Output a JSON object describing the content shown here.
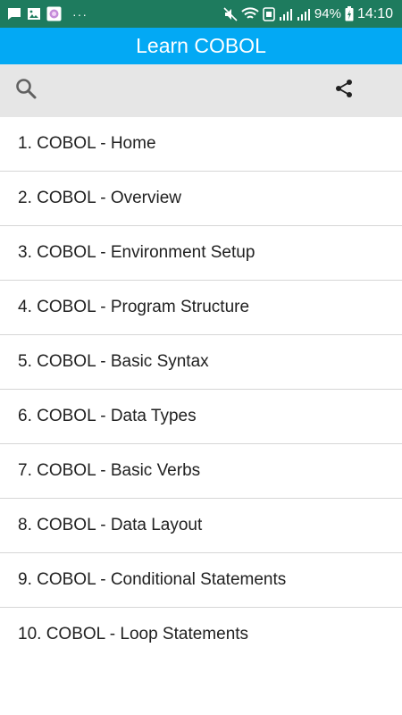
{
  "status_bar": {
    "battery": "94%",
    "time": "14:10",
    "overflow": "···",
    "icons": [
      "message-icon",
      "gallery-icon",
      "app-icon",
      "mute-icon",
      "wifi-icon",
      "nfc-icon",
      "signal-icon",
      "signal-icon",
      "battery-charging-icon"
    ]
  },
  "app_bar": {
    "title": "Learn COBOL"
  },
  "toolbar": {
    "icons": [
      "search-icon",
      "share-icon"
    ]
  },
  "topics": [
    {
      "label": "1. COBOL - Home"
    },
    {
      "label": "2. COBOL - Overview"
    },
    {
      "label": "3. COBOL - Environment Setup"
    },
    {
      "label": "4. COBOL - Program Structure"
    },
    {
      "label": "5. COBOL - Basic Syntax"
    },
    {
      "label": "6. COBOL - Data Types"
    },
    {
      "label": "7. COBOL - Basic Verbs"
    },
    {
      "label": "8. COBOL - Data Layout"
    },
    {
      "label": "9. COBOL - Conditional Statements"
    },
    {
      "label": "10. COBOL - Loop Statements"
    }
  ],
  "colors": {
    "status_bar": "#1e7b5e",
    "app_bar": "#03a9f4",
    "toolbar": "#e6e6e6",
    "divider": "#d6d6d6"
  }
}
